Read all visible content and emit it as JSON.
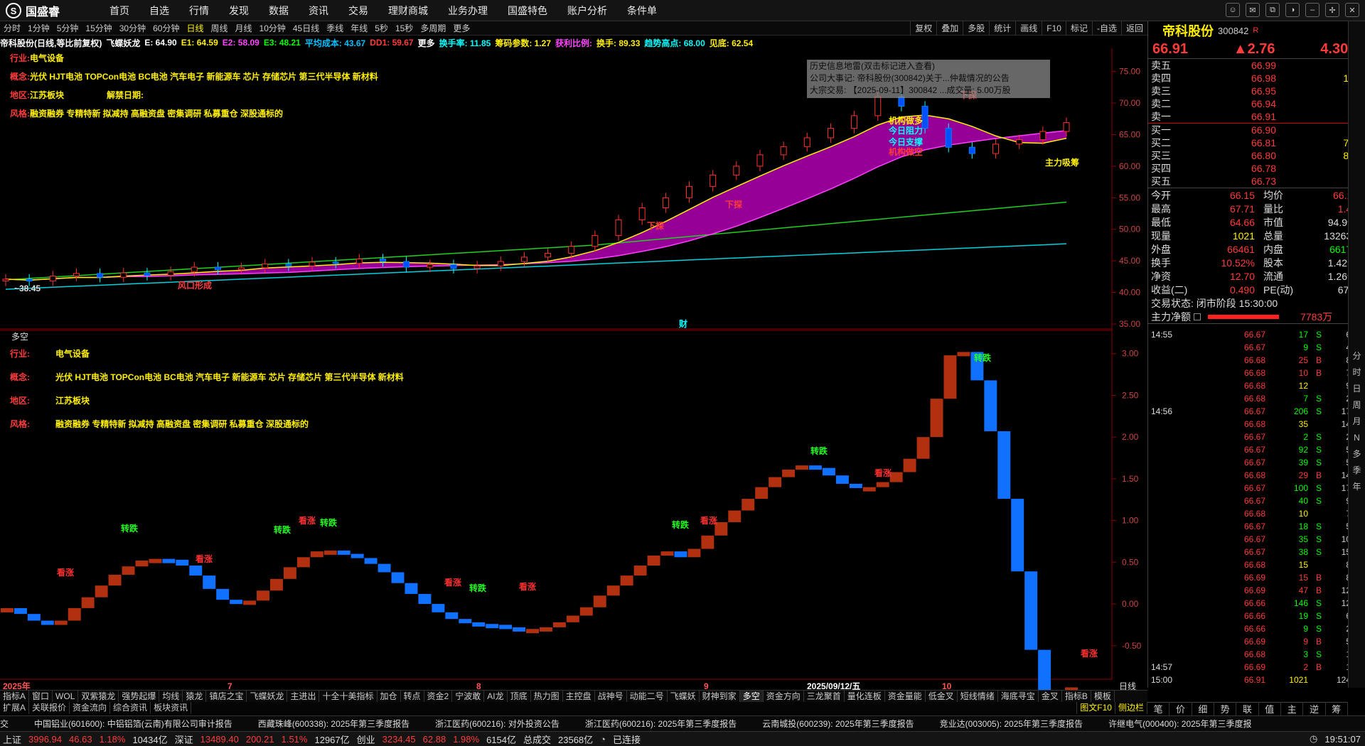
{
  "topbar": {
    "brand": "国盛睿",
    "nav": [
      "首页",
      "自选",
      "行情",
      "发现",
      "数据",
      "资讯",
      "交易",
      "理财商城",
      "业务办理",
      "国盛特色",
      "账户分析",
      "条件单"
    ],
    "window_icons": [
      "chat-icon",
      "mail-icon",
      "restore-icon",
      "skin-icon",
      "minimize-icon",
      "maximize-icon",
      "close-icon"
    ]
  },
  "periods": [
    "分时",
    "1分钟",
    "5分钟",
    "15分钟",
    "30分钟",
    "60分钟",
    "日线",
    "周线",
    "月线",
    "10分钟",
    "45日线",
    "季线",
    "年线",
    "5秒",
    "15秒",
    "多周期",
    "更多"
  ],
  "active_period": "日线",
  "chart_tools": [
    "复权",
    "叠加",
    "多股",
    "统计",
    "画线",
    "F10",
    "标记",
    "-自选",
    "返回"
  ],
  "indicator_line": [
    {
      "t": "帝科股份(日线,等比前复权)",
      "c": "#ffffff"
    },
    {
      "t": "飞蝶妖龙",
      "c": "#ffffff"
    },
    {
      "t": "E: 64.90",
      "c": "#ffffff"
    },
    {
      "t": "E1: 64.59",
      "c": "#ffef00"
    },
    {
      "t": "E2: 58.09",
      "c": "#ff44ff"
    },
    {
      "t": "E3: 48.21",
      "c": "#00ff00"
    },
    {
      "t": "平均成本: 43.67",
      "c": "#00c0ff"
    },
    {
      "t": "DD1: 59.67",
      "c": "#ff3b3b"
    },
    {
      "t": "更多",
      "c": "#ffffff"
    },
    {
      "t": "换手率: 11.85",
      "c": "#00ffff"
    },
    {
      "t": "筹码参数: 1.27",
      "c": "#ffef00"
    },
    {
      "t": "获利比例:",
      "c": "#ff44ff"
    },
    {
      "t": "换手: 89.33",
      "c": "#ffef00"
    },
    {
      "t": "趋势高点: 68.00",
      "c": "#00ffff"
    },
    {
      "t": "见底: 62.54",
      "c": "#ffef00"
    }
  ],
  "tags": {
    "industry_label": "行业:",
    "industry": "电气设备",
    "concept_label": "概念:",
    "concept": "光伏 HJT电池 TOPCon电池 BC电池 汽车电子 新能源车 芯片 存储芯片 第三代半导体 新材料",
    "region_label": "地区:",
    "region": "江苏板块",
    "unlock": "解禁日期:",
    "style_label": "风格:",
    "style": "融资融券 专精特新 拟减持 高融资盘 密集调研 私募重仓 深股通标的"
  },
  "tooltip": {
    "l1": "历史信息地雷(双击标记进入查看)",
    "l2": "公司大事记: 帝科股份(300842)关于...仲裁情况的公告",
    "l3": "大宗交易: 【2025-09-11】300842 ...成交量: 5.00万股"
  },
  "chart_data": [
    {
      "type": "candlestick",
      "title": "飞蝶妖龙",
      "ylim": [
        35,
        78
      ],
      "yticks": [
        "75.00",
        "70.00",
        "65.00",
        "60.00",
        "55.00",
        "50.00",
        "45.00",
        "40.00",
        "35.00"
      ],
      "x_labels": [
        "2025年",
        "7",
        "8",
        "9",
        "2025/09/12/五",
        "10"
      ],
      "annotations": [
        "下探",
        "下探",
        "下探",
        "风口形成",
        "主力吸筹",
        "今日阻力",
        "今日支撑",
        "机构做空",
        "机构做多",
        "~38.45",
        "财"
      ],
      "series": [
        {
          "values": [
            42.1,
            41.8,
            42.6,
            43.0,
            42.4,
            43.1,
            42.7,
            43.3,
            44.0,
            43.6,
            43.9,
            44.5,
            44.2,
            44.8,
            44.6,
            45.3,
            44.9,
            44.0,
            44.4,
            43.8,
            44.2,
            44.9,
            45.6,
            46.2,
            47.3,
            49.0,
            51.5,
            53.4,
            55.0,
            56.8,
            58.6,
            60.0,
            61.8,
            63.1,
            64.5,
            66.0,
            68.0,
            71.0,
            69.5,
            66.0,
            63.0,
            62.0,
            63.5,
            64.2,
            65.5,
            66.9
          ]
        }
      ]
    },
    {
      "type": "bar",
      "title": "多空",
      "ylim": [
        -0.8,
        3.1
      ],
      "yticks": [
        "3.00",
        "2.50",
        "2.00",
        "1.50",
        "1.00",
        "0.50",
        "0.00",
        "-0.50"
      ],
      "annotations": [
        "看涨",
        "转跌",
        "看涨",
        "转跌",
        "看涨",
        "转跌",
        "看涨",
        "转跌",
        "看涨",
        "转跌",
        "看涨",
        "转跌",
        "看涨",
        "转跌",
        "看涨"
      ],
      "values": [
        -0.05,
        -0.12,
        -0.2,
        -0.22,
        -0.2,
        -0.05,
        0.08,
        0.22,
        0.35,
        0.45,
        0.52,
        0.54,
        0.53,
        0.46,
        0.34,
        0.18,
        0.05,
        0.0,
        0.04,
        0.16,
        0.3,
        0.44,
        0.56,
        0.63,
        0.64,
        0.6,
        0.55,
        0.48,
        0.38,
        0.25,
        0.12,
        0.0,
        -0.1,
        -0.18,
        -0.22,
        -0.24,
        -0.25,
        -0.28,
        -0.3,
        -0.3,
        -0.28,
        -0.22,
        -0.14,
        -0.04,
        0.1,
        0.22,
        0.34,
        0.46,
        0.58,
        0.63,
        0.56,
        0.66,
        0.82,
        0.98,
        1.12,
        1.26,
        1.4,
        1.52,
        1.61,
        1.66,
        1.63,
        1.54,
        1.44,
        1.39,
        1.4,
        1.46,
        1.58,
        1.74,
        2.0,
        2.46,
        2.98,
        3.02,
        2.68,
        2.07,
        1.26,
        0.39,
        -0.55,
        -1.12,
        -1.3,
        -1.0
      ]
    }
  ],
  "quote": {
    "name": "帝科股份",
    "code": "300842",
    "price": "66.91",
    "change": "▲2.76",
    "pct": "4.30%",
    "asks": [
      [
        "卖五",
        "66.99",
        "6"
      ],
      [
        "卖四",
        "66.98",
        "12"
      ],
      [
        "卖三",
        "66.95",
        "6"
      ],
      [
        "卖二",
        "66.94",
        "1"
      ],
      [
        "卖一",
        "66.91",
        "4"
      ]
    ],
    "bids": [
      [
        "买一",
        "66.90",
        "6"
      ],
      [
        "买二",
        "66.81",
        "71"
      ],
      [
        "买三",
        "66.80",
        "81"
      ],
      [
        "买四",
        "66.78",
        "1"
      ],
      [
        "买五",
        "66.73",
        "3"
      ]
    ],
    "stats": [
      [
        "今开",
        "66.15",
        "均价",
        "66.11"
      ],
      [
        "最高",
        "67.71",
        "量比",
        "1.43"
      ],
      [
        "最低",
        "64.66",
        "市值",
        "94.9亿"
      ],
      [
        "现量",
        "1021",
        "总量",
        "132639"
      ],
      [
        "外盘",
        "66461",
        "内盘",
        "66178"
      ],
      [
        "换手",
        "10.52%",
        "股本",
        "1.42亿"
      ],
      [
        "净资",
        "12.70",
        "流通",
        "1.26亿"
      ],
      [
        "收益(二)",
        "0.490",
        "PE(动)",
        "67.9"
      ]
    ],
    "trade_state": "交易状态: 闭市阶段 15:30:00",
    "net_label": "主力净额",
    "net_value": "7783万",
    "net_pct": "9%",
    "ticks": [
      [
        "14:55",
        "66.67",
        "17",
        "S",
        "6"
      ],
      [
        "",
        "66.67",
        "9",
        "S",
        "4"
      ],
      [
        "",
        "66.68",
        "25",
        "B",
        "8"
      ],
      [
        "",
        "66.68",
        "10",
        "B",
        "7"
      ],
      [
        "",
        "66.68",
        "12",
        "",
        "9"
      ],
      [
        "",
        "66.68",
        "7",
        "S",
        "2"
      ],
      [
        "14:56",
        "66.67",
        "206",
        "S",
        "17"
      ],
      [
        "",
        "66.68",
        "35",
        "",
        "14"
      ],
      [
        "",
        "66.67",
        "2",
        "S",
        "2"
      ],
      [
        "",
        "66.67",
        "92",
        "S",
        "5"
      ],
      [
        "",
        "66.67",
        "39",
        "S",
        "5"
      ],
      [
        "",
        "66.68",
        "29",
        "B",
        "14"
      ],
      [
        "",
        "66.67",
        "100",
        "S",
        "17"
      ],
      [
        "",
        "66.67",
        "40",
        "S",
        "9"
      ],
      [
        "",
        "66.68",
        "10",
        "",
        "7"
      ],
      [
        "",
        "66.67",
        "18",
        "S",
        "5"
      ],
      [
        "",
        "66.67",
        "35",
        "S",
        "10"
      ],
      [
        "",
        "66.67",
        "38",
        "S",
        "15"
      ],
      [
        "",
        "66.68",
        "15",
        "",
        "8"
      ],
      [
        "",
        "66.69",
        "15",
        "B",
        "8"
      ],
      [
        "",
        "66.69",
        "47",
        "B",
        "12"
      ],
      [
        "",
        "66.66",
        "146",
        "S",
        "12"
      ],
      [
        "",
        "66.66",
        "19",
        "S",
        "6"
      ],
      [
        "",
        "66.66",
        "9",
        "S",
        "2"
      ],
      [
        "",
        "66.69",
        "9",
        "B",
        "5"
      ],
      [
        "",
        "66.68",
        "3",
        "S",
        "1"
      ],
      [
        "14:57",
        "66.69",
        "2",
        "B",
        "1"
      ],
      [
        "15:00",
        "66.91",
        "1021",
        "",
        "124"
      ]
    ]
  },
  "sidebar": [
    "分",
    "时",
    "日",
    "周",
    "月",
    "N",
    "多",
    "季",
    "年"
  ],
  "indicators": [
    "指标A",
    "窗口",
    "WOL",
    "双紫猿龙",
    "强势起爆",
    "均线",
    "猿龙",
    "镇店之宝",
    "飞蝶妖龙",
    "主进出",
    "十全十美指标",
    "加仓",
    "转点",
    "资金2",
    "宁波敢",
    "AI龙",
    "顶底",
    "热力图",
    "主控盘",
    "战神号",
    "动能二号",
    "飞蝶妖",
    "财神到家",
    "多空",
    "资金方向",
    "三龙聚首",
    "量化连板",
    "资金量能",
    "低金叉",
    "短线情绪",
    "海底寻宝",
    "金叉",
    "指标B",
    "模板"
  ],
  "active_indicator": "多空",
  "subtabs": [
    "扩展A",
    "关联报价",
    "资金流向",
    "综合资讯",
    "板块资讯"
  ],
  "right_tabs": [
    "图文F10",
    "侧边栏"
  ],
  "period_label": "日线",
  "qtabs": [
    "笔",
    "价",
    "细",
    "势",
    "联",
    "值",
    "主",
    "逆",
    "筹"
  ],
  "ticker": [
    "交",
    "中国铝业(601600): 中铝铝箔(云南)有限公司审计报告",
    "西藏珠峰(600338): 2025年第三季度报告",
    "浙江医药(600216): 对外投资公告",
    "浙江医药(600216): 2025年第三季度报告",
    "云南城投(600239): 2025年第三季度报告",
    "竞业达(003005): 2025年第三季度报告",
    "许继电气(000400): 2025年第三季度报"
  ],
  "status": {
    "sh_label": "上证",
    "sh": "3996.94",
    "sh_chg": "46.63",
    "sh_pct": "1.18%",
    "sh_amt": "10434亿",
    "sz_label": "深证",
    "sz": "13489.40",
    "sz_chg": "200.21",
    "sz_pct": "1.51%",
    "sz_amt": "12967亿",
    "cy_label": "创业",
    "cy": "3234.45",
    "cy_chg": "62.88",
    "cy_pct": "1.98%",
    "cy_amt": "6154亿",
    "total_label": "总成交",
    "total": "23568亿",
    "conn": "已连接",
    "time": "19:51:07"
  }
}
